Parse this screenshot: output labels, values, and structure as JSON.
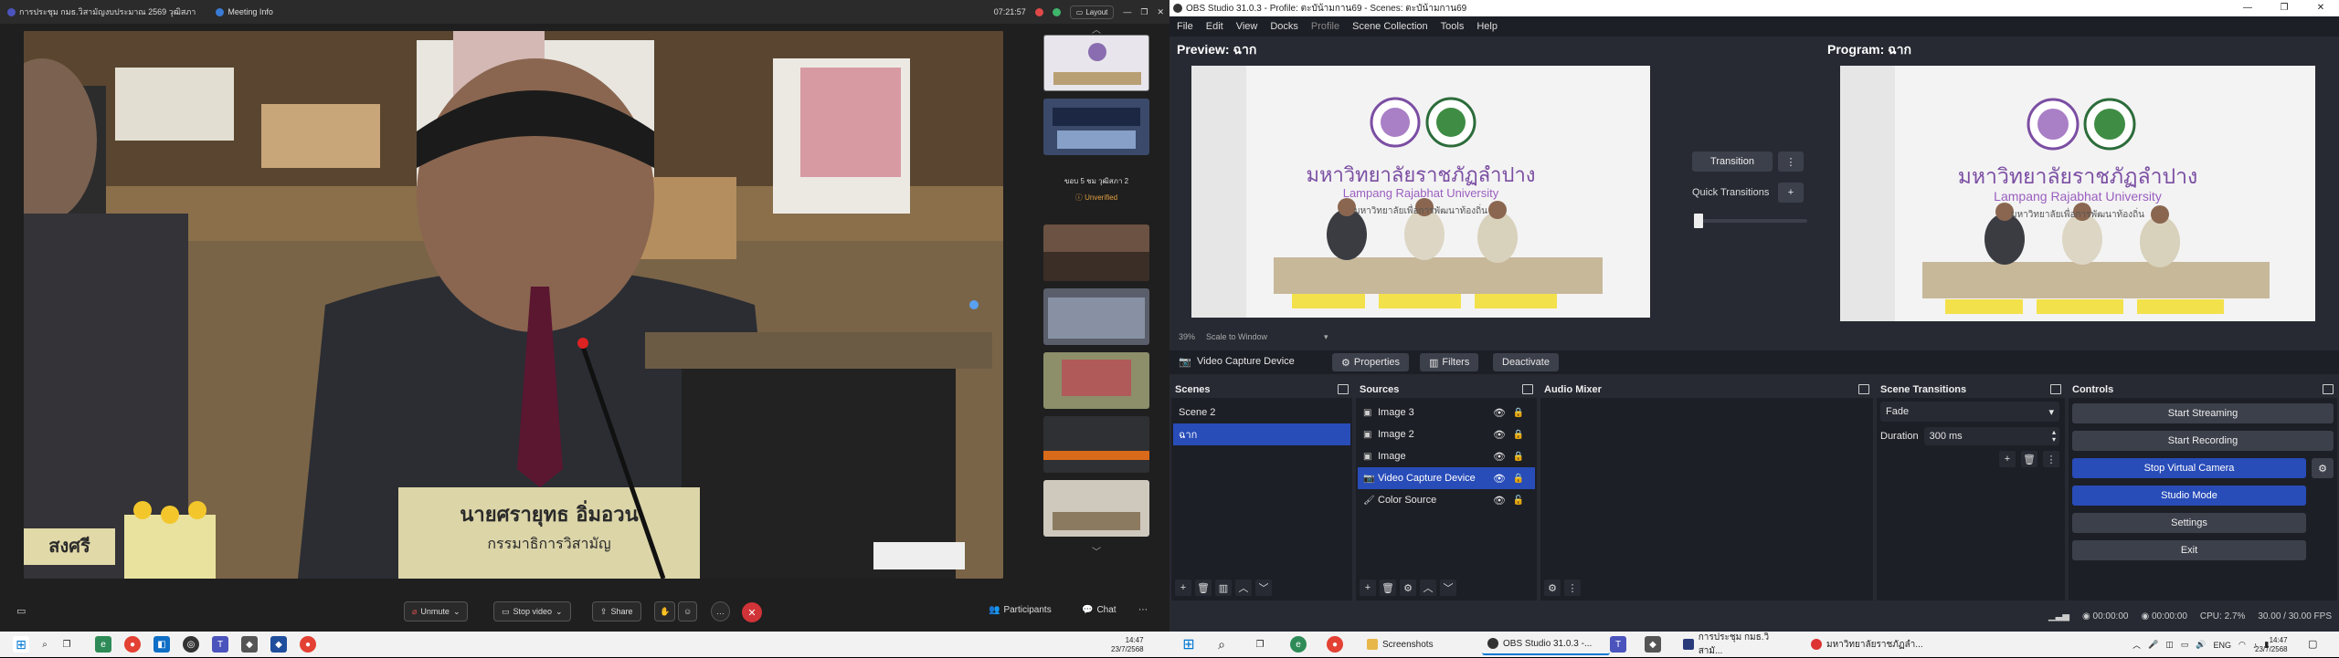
{
  "teams": {
    "title": "การประชุม กมธ.วิสามัญงบประมาณ 2569 วุฒิสภา",
    "meeting_info": "Meeting Info",
    "time": "07:21:57",
    "layout_label": "Layout",
    "nameplate_name": "นายศรายุทธ อิ่มอวน",
    "nameplate_role": "กรรมาธิการวิสามัญ",
    "left_name": "สงศรี",
    "participant_label": "ขอบ 5 ชม วุฒิสภา 2",
    "unverified": "Unverified",
    "toolbar": {
      "unmute": "Unmute",
      "stop_video": "Stop video",
      "share": "Share",
      "participants": "Participants",
      "chat": "Chat"
    }
  },
  "obs": {
    "window_title": "OBS Studio 31.0.3 - Profile: ตะบัน้ามกาน69 - Scenes: ตะบัน้ามกาน69",
    "menu": [
      "File",
      "Edit",
      "View",
      "Docks",
      "Profile",
      "Scene Collection",
      "Tools",
      "Help"
    ],
    "preview_label": "Preview: ฉาก",
    "program_label": "Program: ฉาก",
    "transition_btn": "Transition",
    "quick_transitions": "Quick Transitions",
    "zoom": "39%",
    "scale_mode": "Scale to Window",
    "uni_thai": "มหาวิทยาลัยราชภัฏลำปาง",
    "uni_en": "Lampang Rajabhat University",
    "uni_motto": "มหาวิทยาลัยเพื่อการพัฒนาท้องถิ่น",
    "context": {
      "source": "Video Capture Device",
      "properties": "Properties",
      "filters": "Filters",
      "deactivate": "Deactivate"
    },
    "scenes": {
      "title": "Scenes",
      "items": [
        "Scene 2",
        "ฉาก"
      ]
    },
    "sources": {
      "title": "Sources",
      "items": [
        "Image 3",
        "Image 2",
        "Image",
        "Video Capture Device",
        "Color Source"
      ]
    },
    "audio_mixer": {
      "title": "Audio Mixer"
    },
    "scene_transitions": {
      "title": "Scene Transitions",
      "type": "Fade",
      "duration_label": "Duration",
      "duration_value": "300 ms"
    },
    "controls": {
      "title": "Controls",
      "start_streaming": "Start Streaming",
      "start_recording": "Start Recording",
      "stop_virtual_camera": "Stop Virtual Camera",
      "studio_mode": "Studio Mode",
      "settings": "Settings",
      "exit": "Exit"
    },
    "status": {
      "stream_time": "00:00:00",
      "rec_time": "00:00:00",
      "cpu": "CPU: 2.7%",
      "fps": "30.00 / 30.00 FPS"
    }
  },
  "taskbar": {
    "left_time": "14:47",
    "left_date": "23/7/2568",
    "apps": [
      {
        "label": "Screenshots",
        "icon": "folder-icon",
        "color": "#e8b74a"
      },
      {
        "label": "OBS Studio 31.0.3 -...",
        "icon": "obs-icon",
        "color": "#333333"
      },
      {
        "label": "การประชุม กมธ.วิสามั...",
        "icon": "teams-icon",
        "color": "#283a7a"
      },
      {
        "label": "มหาวิทยาลัยราชภัฏลำ...",
        "icon": "chrome-icon",
        "color": "#d33"
      }
    ],
    "lang": "ENG",
    "right_time": "14:47",
    "right_date": "23/7/2568"
  }
}
